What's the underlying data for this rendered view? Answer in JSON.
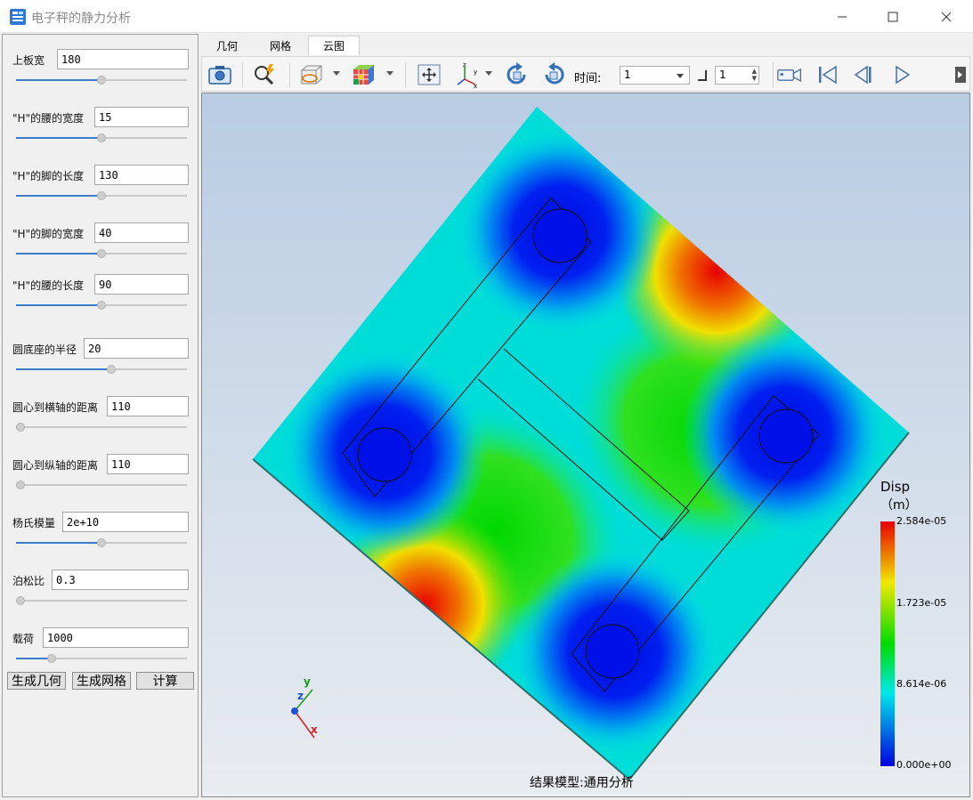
{
  "window": {
    "title": "电子秤的静力分析",
    "min_glyph": "—",
    "max_glyph": "☐",
    "close_glyph": "✕"
  },
  "params": [
    {
      "label": "上板宽",
      "value": "180",
      "slider": 0.5
    },
    {
      "label": "\"H\"的腰的宽度",
      "value": "15",
      "slider": 0.5
    },
    {
      "label": "\"H\"的脚的长度",
      "value": "130",
      "slider": 0.5
    },
    {
      "label": "\"H\"的脚的宽度",
      "value": "40",
      "slider": 0.5
    },
    {
      "label": "\"H\"的腰的长度",
      "value": "90",
      "slider": 0.5
    },
    {
      "label": "圆底座的半径",
      "value": "20",
      "slider": 0.56
    },
    {
      "label": "圆心到横轴的距离",
      "value": "110",
      "slider": 0.0
    },
    {
      "label": "圆心到纵轴的距离",
      "value": "110",
      "slider": 0.0
    },
    {
      "label": "杨氏模量",
      "value": "2e+10",
      "slider": 0.5
    },
    {
      "label": "泊松比",
      "value": "0.3",
      "slider": 0.0
    },
    {
      "label": "载荷",
      "value": "1000",
      "slider": 0.19
    }
  ],
  "actions": {
    "gen_geom": "生成几何",
    "gen_mesh": "生成网格",
    "compute": "计算"
  },
  "tabs": [
    "几何",
    "网格",
    "云图"
  ],
  "active_tab": "云图",
  "toolbar": {
    "time_label": "时间:",
    "time_value": "1",
    "step_value": "1"
  },
  "icons": [
    "camera-icon",
    "zoom-icon",
    "view-box-icon",
    "color-cube-icon",
    "fit-view-icon",
    "axes-icon",
    "rotate-cw-icon",
    "rotate-ccw-icon",
    "video-icon",
    "first-frame-icon",
    "prev-frame-icon",
    "play-icon"
  ],
  "legend": {
    "title": "Disp",
    "unit": "（m）",
    "max": "2.584e-05",
    "mid_high": "1.723e-05",
    "mid_low": "8.614e-06",
    "min": "0.000e+00",
    "colors": [
      "#e80000",
      "#f0e800",
      "#00dc00",
      "#00e8e8",
      "#0000e0"
    ]
  },
  "viewport": {
    "caption": "结果模型:通用分析",
    "background_top": "#b8cce3",
    "background_bottom": "#e9ecf0",
    "axes": {
      "x": "x",
      "y": "y",
      "z": "z"
    }
  }
}
